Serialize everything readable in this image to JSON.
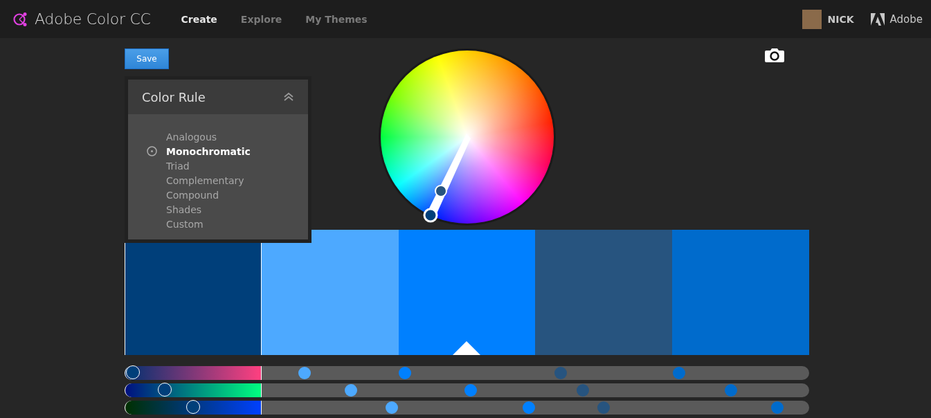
{
  "app": {
    "title": "Adobe Color CC"
  },
  "nav": [
    {
      "label": "Create",
      "selected": true
    },
    {
      "label": "Explore",
      "selected": false
    },
    {
      "label": "My Themes",
      "selected": false
    }
  ],
  "user": {
    "name": "NICK"
  },
  "brand": {
    "label": "Adobe"
  },
  "save_button": "Save",
  "color_rule": {
    "title": "Color Rule",
    "expanded": true,
    "items": [
      {
        "label": "Analogous",
        "selected": false
      },
      {
        "label": "Monochromatic",
        "selected": true
      },
      {
        "label": "Triad",
        "selected": false
      },
      {
        "label": "Complementary",
        "selected": false
      },
      {
        "label": "Compound",
        "selected": false
      },
      {
        "label": "Shades",
        "selected": false
      },
      {
        "label": "Custom",
        "selected": false
      }
    ]
  },
  "swatches": [
    {
      "color": "#003f7a",
      "selected": true,
      "base": false
    },
    {
      "color": "#4da9ff",
      "selected": false,
      "base": false
    },
    {
      "color": "#0080ff",
      "selected": false,
      "base": true
    },
    {
      "color": "#27547f",
      "selected": false,
      "base": false
    },
    {
      "color": "#006bcc",
      "selected": false,
      "base": false
    }
  ],
  "sliders": [
    {
      "level": 0.055,
      "dots": [
        {
          "color": "#4da9ff",
          "level": 0.263
        },
        {
          "color": "#0080ff",
          "level": 0.41
        },
        {
          "color": "#27547f",
          "level": 0.637
        },
        {
          "color": "#006bcc",
          "level": 0.81
        }
      ]
    },
    {
      "level": 0.29,
      "dots": [
        {
          "color": "#4da9ff",
          "level": 0.331
        },
        {
          "color": "#0080ff",
          "level": 0.506
        },
        {
          "color": "#27547f",
          "level": 0.669
        },
        {
          "color": "#006bcc",
          "level": 0.886
        }
      ]
    },
    {
      "level": 0.5,
      "dots": [
        {
          "color": "#4da9ff",
          "level": 0.39
        },
        {
          "color": "#0080ff",
          "level": 0.59
        },
        {
          "color": "#27547f",
          "level": 0.7
        },
        {
          "color": "#006bcc",
          "level": 0.953
        }
      ]
    }
  ]
}
